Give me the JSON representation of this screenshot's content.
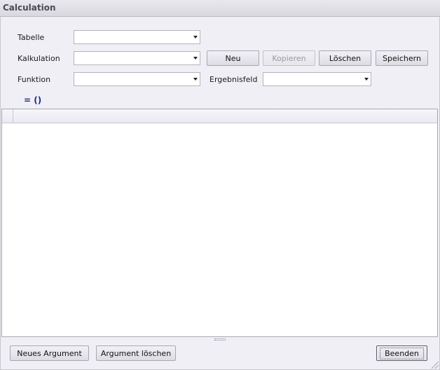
{
  "window": {
    "title": "Calculation"
  },
  "form": {
    "tabelle_label": "Tabelle",
    "kalkulation_label": "Kalkulation",
    "funktion_label": "Funktion",
    "ergebnisfeld_label": "Ergebnisfeld",
    "tabelle_value": "",
    "kalkulation_value": "",
    "funktion_value": "",
    "ergebnisfeld_value": ""
  },
  "toolbar": {
    "neu": "Neu",
    "kopieren": "Kopieren",
    "loeschen": "Löschen",
    "speichern": "Speichern"
  },
  "formula": "= ()",
  "footer": {
    "neues_argument": "Neues Argument",
    "argument_loeschen": "Argument löschen",
    "beenden": "Beenden"
  },
  "icons": [
    "dropdown-arrow-icon",
    "resize-grip-icon",
    "splitter-handle-icon"
  ]
}
